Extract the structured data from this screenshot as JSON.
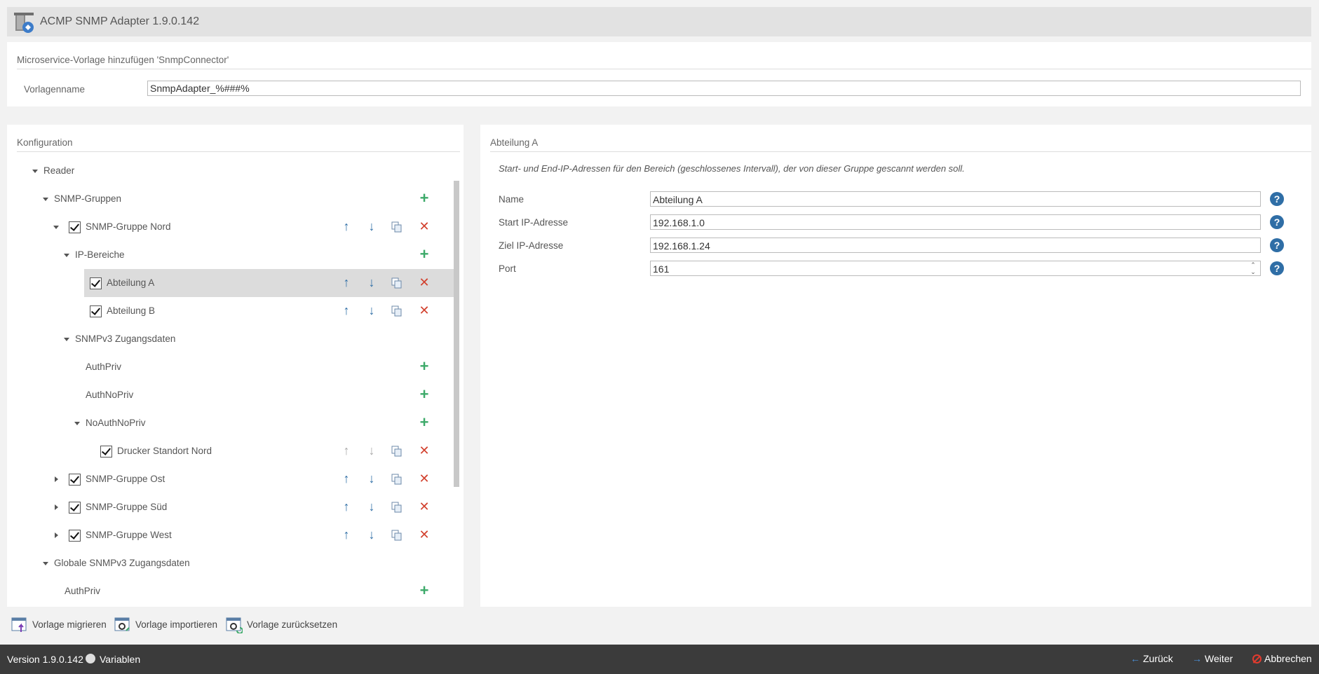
{
  "window": {
    "title": "ACMP SNMP Adapter 1.9.0.142"
  },
  "template": {
    "section_title": "Microservice-Vorlage hinzufügen 'SnmpConnector'",
    "name_label": "Vorlagenname",
    "name_value": "SnmpAdapter_%###%"
  },
  "config": {
    "title": "Konfiguration",
    "tree": [
      {
        "label": "Reader"
      },
      {
        "label": "SNMP-Gruppen"
      },
      {
        "label": "SNMP-Gruppe Nord",
        "checked": true
      },
      {
        "label": "IP-Bereiche"
      },
      {
        "label": "Abteilung A",
        "checked": true,
        "selected": true
      },
      {
        "label": "Abteilung B",
        "checked": true
      },
      {
        "label": "SNMPv3 Zugangsdaten"
      },
      {
        "label": "AuthPriv"
      },
      {
        "label": "AuthNoPriv"
      },
      {
        "label": "NoAuthNoPriv"
      },
      {
        "label": "Drucker Standort Nord",
        "checked": true
      },
      {
        "label": "SNMP-Gruppe Ost",
        "checked": true
      },
      {
        "label": "SNMP-Gruppe Süd",
        "checked": true
      },
      {
        "label": "SNMP-Gruppe West",
        "checked": true
      },
      {
        "label": "Globale SNMPv3 Zugangsdaten"
      },
      {
        "label": "AuthPriv"
      }
    ]
  },
  "details": {
    "title": "Abteilung A",
    "description": "Start- und End-IP-Adressen für den Bereich (geschlossenes Intervall), der von dieser Gruppe gescannt werden soll.",
    "fields": [
      {
        "label": "Name",
        "value": "Abteilung A"
      },
      {
        "label": "Start IP-Adresse",
        "value": "192.168.1.0"
      },
      {
        "label": "Ziel IP-Adresse",
        "value": "192.168.1.24"
      },
      {
        "label": "Port",
        "value": "161"
      }
    ]
  },
  "toolbar": {
    "migrate": "Vorlage migrieren",
    "import": "Vorlage importieren",
    "reset": "Vorlage zurücksetzen"
  },
  "footer": {
    "version": "Version 1.9.0.142",
    "variables": "Variablen",
    "back": "Zurück",
    "next": "Weiter",
    "cancel": "Abbrechen"
  },
  "colors": {
    "accent": "#2f6ea6",
    "delete": "#d2412e",
    "add": "#3daa6a",
    "footer_bg": "#3b3b3b"
  }
}
